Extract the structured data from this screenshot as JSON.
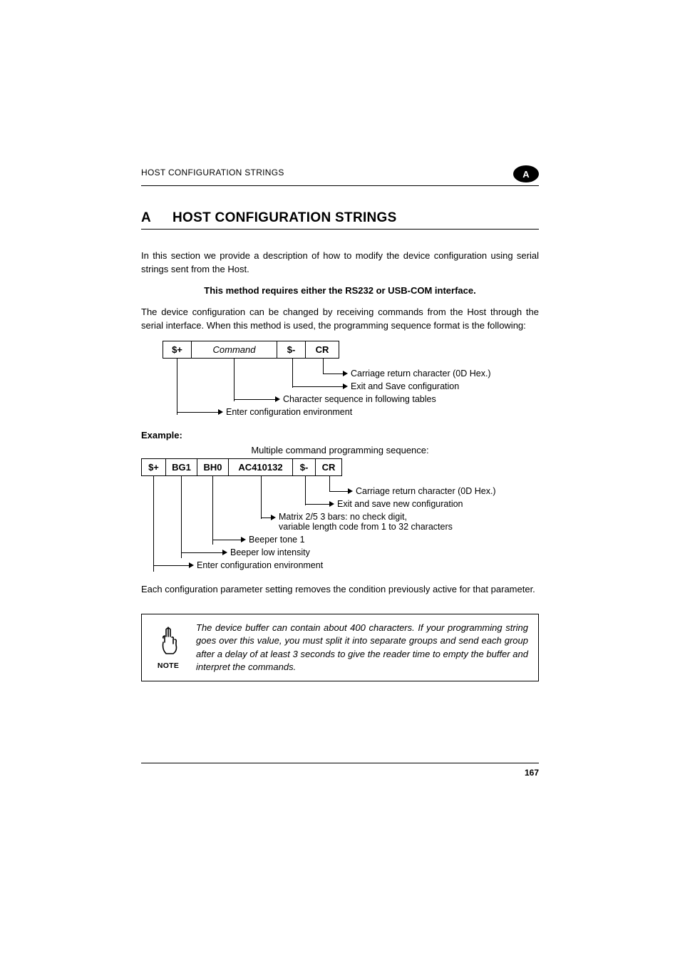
{
  "header": {
    "running_head": "HOST CONFIGURATION STRINGS",
    "badge": "A"
  },
  "section": {
    "letter": "A",
    "title": "HOST CONFIGURATION STRINGS"
  },
  "body": {
    "intro": "In this section we provide a description of how to modify the device configuration using serial strings sent from the Host.",
    "requirement": "This method requires either the RS232 or USB-COM interface.",
    "para2": "The device configuration can be changed by receiving commands from the Host through the serial interface. When this method is used, the programming sequence format is the following:"
  },
  "diagram1": {
    "boxes": [
      "$+",
      "Command",
      "$-",
      "CR"
    ],
    "legend": [
      "Carriage return character (0D Hex.)",
      "Exit and Save configuration",
      "Character sequence in following tables",
      "Enter configuration environment"
    ]
  },
  "example": {
    "label": "Example:",
    "caption": "Multiple command programming sequence:"
  },
  "diagram2": {
    "boxes": [
      "$+",
      "BG1",
      "BH0",
      "AC410132",
      "$-",
      "CR"
    ],
    "legend": [
      "Carriage return character (0D Hex.)",
      "Exit and save new configuration",
      "Matrix 2/5 3 bars: no check digit,\nvariable length code from 1 to 32 characters",
      "Beeper tone 1",
      "Beeper low intensity",
      "Enter configuration environment"
    ]
  },
  "closing": "Each configuration parameter setting removes the condition previously active for that parameter.",
  "note": {
    "label": "NOTE",
    "text": "The device buffer can contain about 400 characters. If your programming string goes over this value, you must split it into separate groups and send each group after a delay of at least 3 seconds to give the reader time to empty the buffer and interpret the commands."
  },
  "footer": {
    "page": "167"
  }
}
